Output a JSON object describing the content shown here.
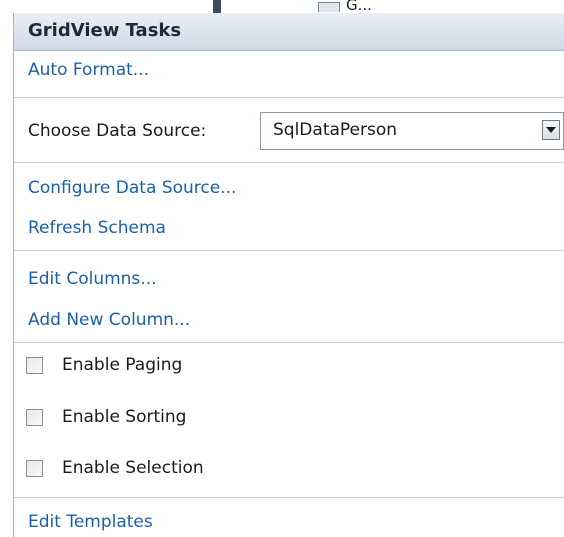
{
  "background": {
    "partial_text": "G..."
  },
  "panel": {
    "title": "GridView Tasks",
    "auto_format": "Auto Format...",
    "choose_data_source_label": "Choose Data Source:",
    "data_source_value": "SqlDataPerson",
    "configure_data_source": "Configure Data Source...",
    "refresh_schema": "Refresh Schema",
    "edit_columns": "Edit Columns...",
    "add_new_column": "Add New Column...",
    "enable_paging": "Enable Paging",
    "enable_sorting": "Enable Sorting",
    "enable_selection": "Enable Selection",
    "edit_templates": "Edit Templates"
  },
  "colors": {
    "link": "#1c5fa8",
    "header_bg": "#cfd9e6",
    "separator": "#c8cdd4"
  },
  "icons": {
    "dropdown": "chevron-down-icon"
  },
  "state": {
    "enable_paging": false,
    "enable_sorting": false,
    "enable_selection": false
  }
}
